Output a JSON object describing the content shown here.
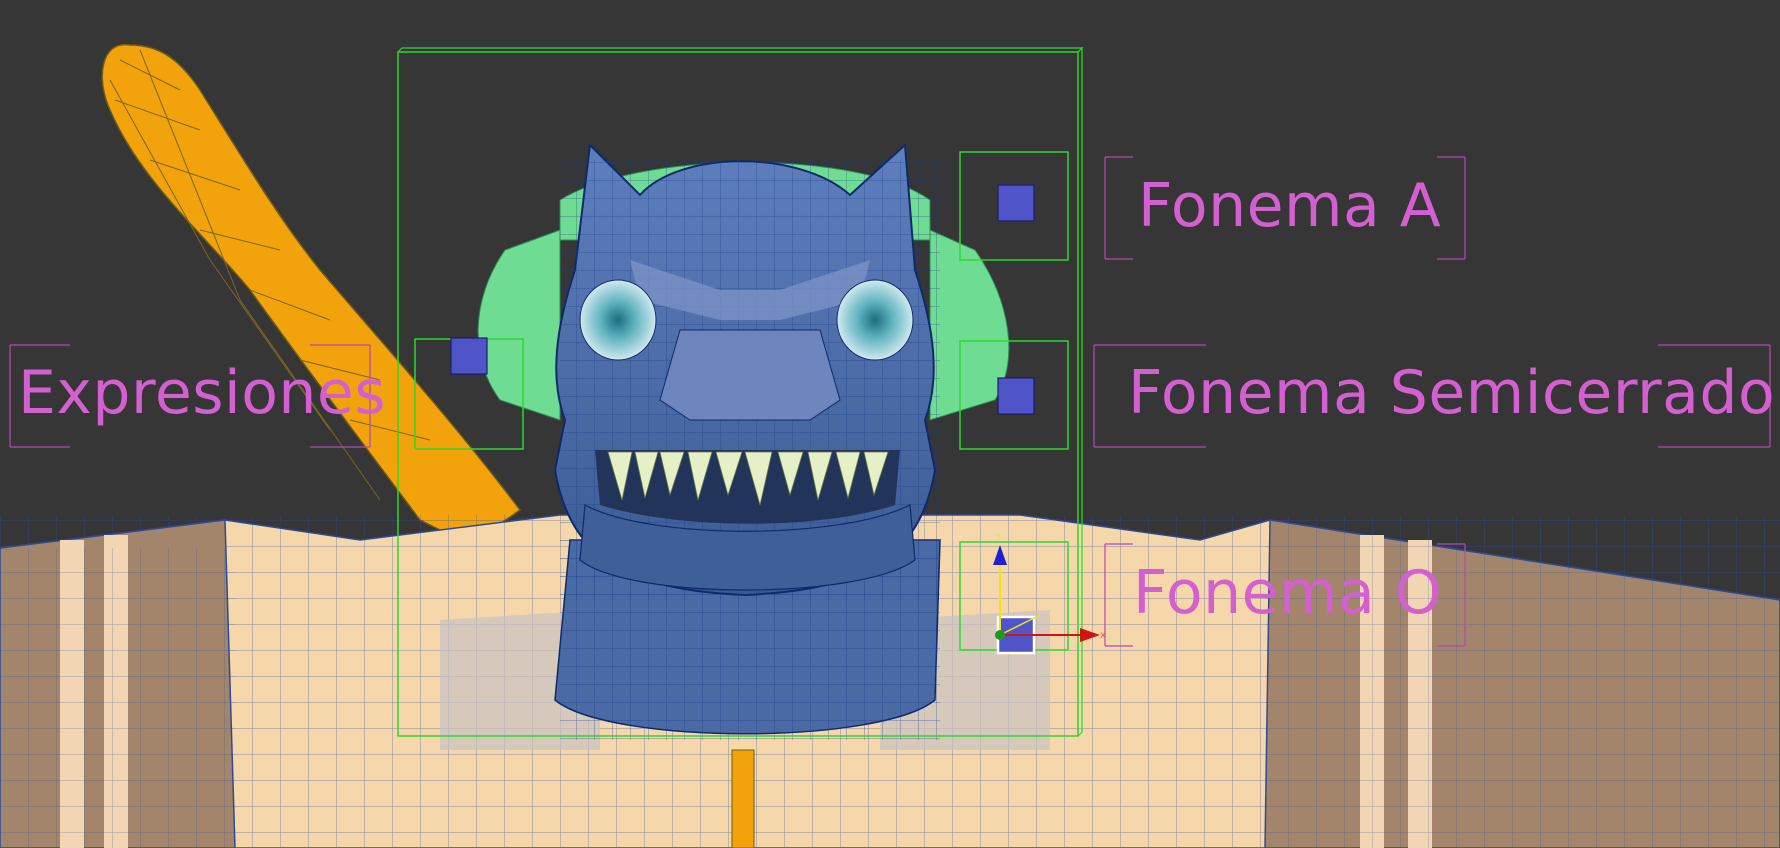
{
  "viewport": {
    "background": "#363636",
    "mesh_wire_color": "#1d3f8f",
    "bbox_color": "#2bd92b",
    "label_color": "#d35fd1",
    "handle_color": "#4f55c9"
  },
  "labels": {
    "fonema_a": "Fonema A",
    "expresiones": "Expresiones",
    "fonema_semicerrado": "Fonema Semicerrado",
    "fonema_o": "Fonema O"
  },
  "gizmo": {
    "z_axis": "z",
    "x_axis": "x"
  },
  "icons": {
    "gizmo": "move-gizmo-icon"
  }
}
